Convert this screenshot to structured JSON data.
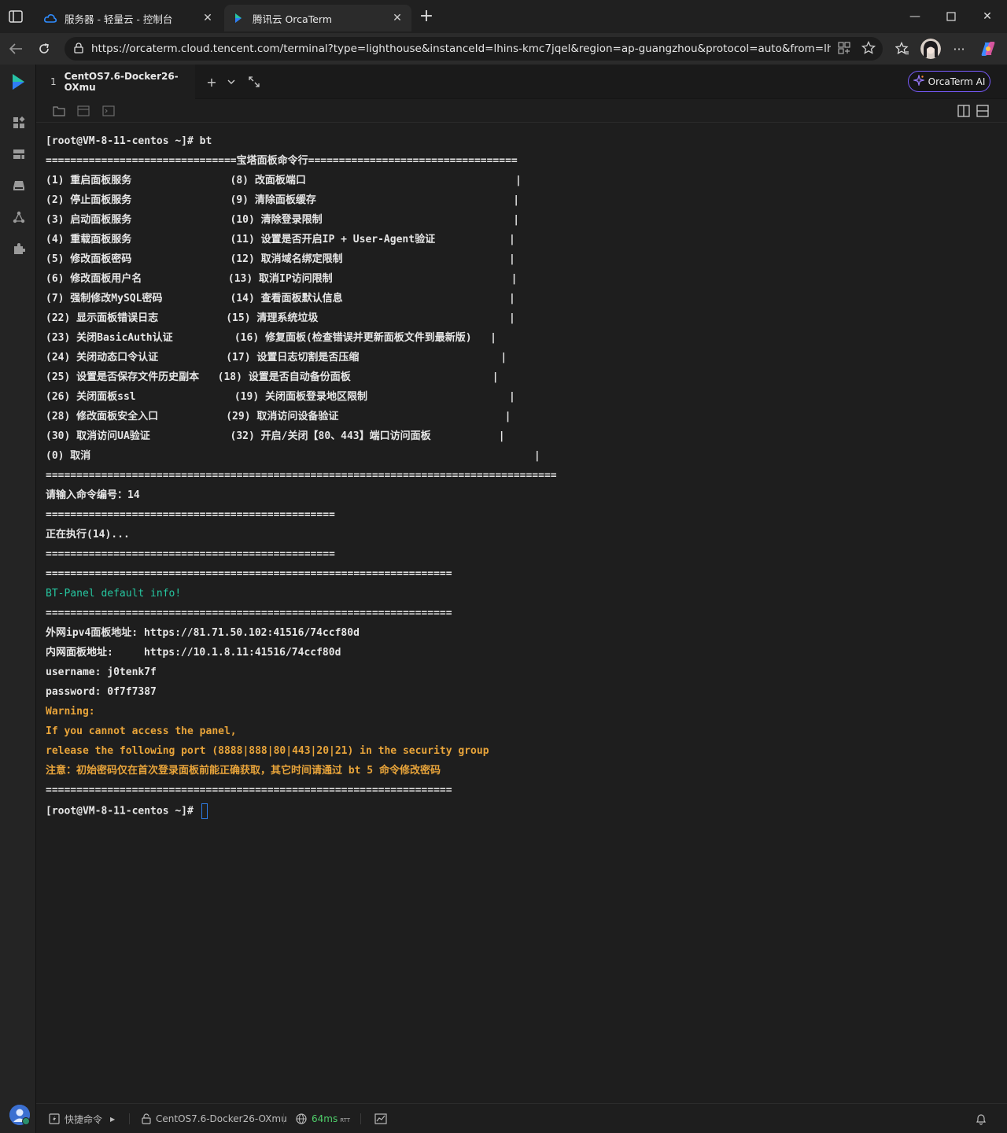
{
  "browser": {
    "tabs": [
      {
        "title": "服务器 - 轻量云 - 控制台",
        "active": false,
        "icon": "cloud-icon"
      },
      {
        "title": "腾讯云 OrcaTerm",
        "active": true,
        "icon": "orcaterm-icon"
      }
    ],
    "url": "https://orcaterm.cloud.tencent.com/terminal?type=lighthouse&instanceId=lhins-kmc7jqel&region=ap-guangzhou&protocol=auto&from=lh_console_..."
  },
  "app": {
    "session_tab": {
      "number": "1",
      "title": "CentOS7.6-Docker26-OXmu"
    },
    "ai_button": "OrcaTerm AI",
    "accent": "#7a5cff"
  },
  "terminal": {
    "lines": [
      {
        "text": "[root@VM-8-11-centos ~]# bt",
        "style": "normal"
      },
      {
        "text": "===============================宝塔面板命令行==================================",
        "style": "normal"
      },
      {
        "text": "(1) 重启面板服务                (8) 改面板端口                                  |",
        "style": "normal"
      },
      {
        "text": "(2) 停止面板服务                (9) 清除面板缓存                                |",
        "style": "normal"
      },
      {
        "text": "(3) 启动面板服务                (10) 清除登录限制                               |",
        "style": "normal"
      },
      {
        "text": "(4) 重载面板服务                (11) 设置是否开启IP + User-Agent验证            |",
        "style": "normal"
      },
      {
        "text": "(5) 修改面板密码                (12) 取消域名绑定限制                           |",
        "style": "normal"
      },
      {
        "text": "(6) 修改面板用户名              (13) 取消IP访问限制                             |",
        "style": "normal"
      },
      {
        "text": "(7) 强制修改MySQL密码           (14) 查看面板默认信息                           |",
        "style": "normal"
      },
      {
        "text": "(22) 显示面板错误日志           (15) 清理系统垃圾                               |",
        "style": "normal"
      },
      {
        "text": "(23) 关闭BasicAuth认证          (16) 修复面板(检查错误并更新面板文件到最新版)   |",
        "style": "normal"
      },
      {
        "text": "(24) 关闭动态口令认证           (17) 设置日志切割是否压缩                       |",
        "style": "normal"
      },
      {
        "text": "(25) 设置是否保存文件历史副本   (18) 设置是否自动备份面板                       |",
        "style": "normal"
      },
      {
        "text": "(26) 关闭面板ssl                (19) 关闭面板登录地区限制                       |",
        "style": "normal"
      },
      {
        "text": "(28) 修改面板安全入口           (29) 取消访问设备验证                           |",
        "style": "normal"
      },
      {
        "text": "(30) 取消访问UA验证             (32) 开启/关闭【80、443】端口访问面板           |",
        "style": "normal"
      },
      {
        "text": "(0) 取消                                                                        |",
        "style": "normal"
      },
      {
        "text": "===================================================================================",
        "style": "normal"
      },
      {
        "text": "请输入命令编号：14",
        "style": "normal"
      },
      {
        "text": "===============================================",
        "style": "normal"
      },
      {
        "text": "正在执行(14)...",
        "style": "normal"
      },
      {
        "text": "===============================================",
        "style": "normal"
      },
      {
        "text": "==================================================================",
        "style": "normal"
      },
      {
        "text": "BT-Panel default info!",
        "style": "teal"
      },
      {
        "text": "==================================================================",
        "style": "normal"
      },
      {
        "text": "外网ipv4面板地址: https://81.71.50.102:41516/74ccf80d",
        "style": "normal"
      },
      {
        "text": "内网面板地址:     https://10.1.8.11:41516/74ccf80d",
        "style": "normal"
      },
      {
        "text": "username: j0tenk7f",
        "style": "normal"
      },
      {
        "text": "password: 0f7f7387",
        "style": "normal"
      },
      {
        "text": "Warning:",
        "style": "orange"
      },
      {
        "text": "If you cannot access the panel,",
        "style": "orange"
      },
      {
        "text": "release the following port (8888|888|80|443|20|21) in the security group",
        "style": "orange"
      },
      {
        "text": "注意：初始密码仅在首次登录面板前能正确获取，其它时间请通过 bt 5 命令修改密码",
        "style": "orange"
      },
      {
        "text": "==================================================================",
        "style": "normal"
      }
    ],
    "prompt": "[root@VM-8-11-centos ~]# "
  },
  "statusbar": {
    "quick_commands": "快捷命令",
    "session": "CentOS7.6-Docker26-OXmu",
    "latency": "64ms",
    "latency_unit": "RTT"
  }
}
